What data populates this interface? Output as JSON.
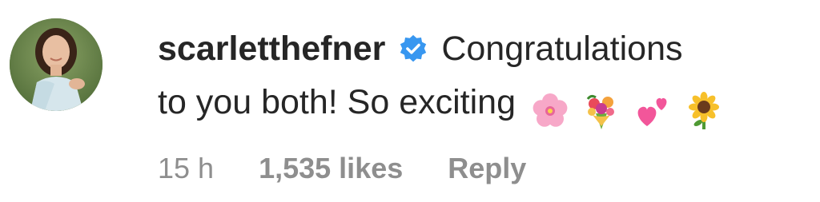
{
  "comment": {
    "username": "scarletthefner",
    "verified_icon": "verified-badge-icon",
    "text_line1": "Congratulations",
    "text_line2": "to you both! So exciting",
    "emojis": [
      "cherry-blossom-icon",
      "bouquet-icon",
      "two-hearts-icon",
      "sunflower-icon"
    ],
    "time": "15 h",
    "likes": "1,535 likes",
    "reply_label": "Reply"
  },
  "colors": {
    "text": "#262626",
    "meta": "#8e8e8e",
    "verified": "#3897f0"
  }
}
